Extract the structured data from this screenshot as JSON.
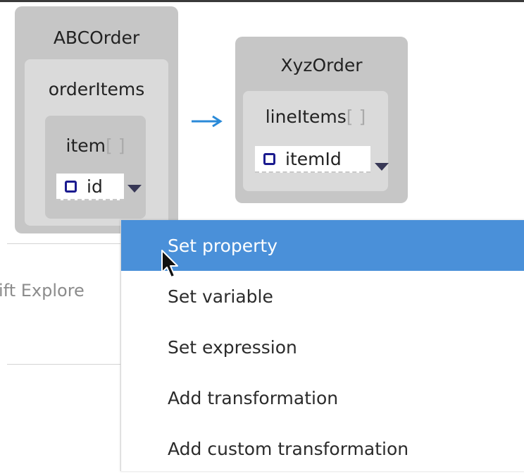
{
  "source": {
    "root_name": "ABCOrder",
    "child_name": "orderItems",
    "collection_name": "item",
    "collection_marker": "[ ]",
    "field_name": "id"
  },
  "target": {
    "root_name": "XyzOrder",
    "collection_name": "lineItems",
    "collection_marker": "[ ]",
    "field_name": "itemId"
  },
  "background": {
    "explorer_label": "ift Explore"
  },
  "context_menu": {
    "items": [
      {
        "label": "Set property",
        "highlighted": true
      },
      {
        "label": "Set variable",
        "highlighted": false
      },
      {
        "label": "Set expression",
        "highlighted": false
      },
      {
        "label": "Add transformation",
        "highlighted": false
      },
      {
        "label": "Add custom transformation",
        "highlighted": false
      }
    ]
  },
  "colors": {
    "accent": "#4a90d9",
    "arrow": "#2a8ad8",
    "panel_dark": "#c6c6c6",
    "panel_light": "#dadada",
    "field_icon": "#1b1b8f"
  },
  "icons": {
    "field": "field-icon",
    "dropdown": "dropdown-arrow-icon",
    "mapping": "right-arrow-icon",
    "cursor": "mouse-pointer-icon"
  }
}
